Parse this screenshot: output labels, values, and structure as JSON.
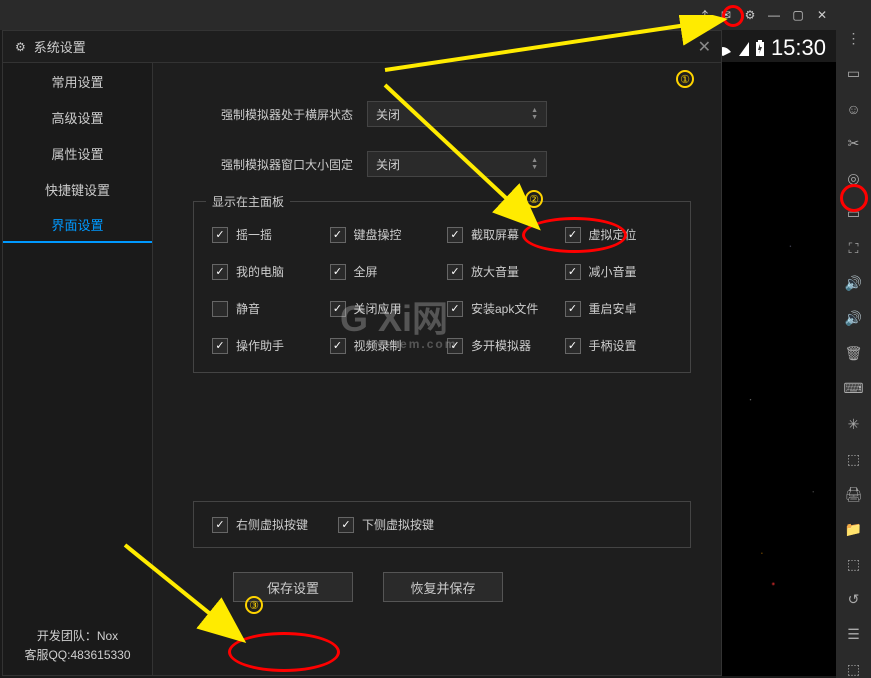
{
  "titlebar": {
    "icons": [
      "pin",
      "mail",
      "gear",
      "min",
      "max",
      "close"
    ]
  },
  "status": {
    "time": "15:30"
  },
  "dialog": {
    "title": "系统设置",
    "tabs": [
      "常用设置",
      "高级设置",
      "属性设置",
      "快捷键设置",
      "界面设置"
    ],
    "active_tab": 4,
    "row1": {
      "label": "强制模拟器处于横屏状态",
      "value": "关闭"
    },
    "row2": {
      "label": "强制模拟器窗口大小固定",
      "value": "关闭"
    },
    "panel_legend": "显示在主面板",
    "checks": [
      {
        "label": "摇一摇",
        "on": true
      },
      {
        "label": "键盘操控",
        "on": true
      },
      {
        "label": "截取屏幕",
        "on": true
      },
      {
        "label": "虚拟定位",
        "on": true
      },
      {
        "label": "我的电脑",
        "on": true
      },
      {
        "label": "全屏",
        "on": true
      },
      {
        "label": "放大音量",
        "on": true
      },
      {
        "label": "减小音量",
        "on": true
      },
      {
        "label": "静音",
        "on": false
      },
      {
        "label": "关闭应用",
        "on": true
      },
      {
        "label": "安装apk文件",
        "on": true
      },
      {
        "label": "重启安卓",
        "on": true
      },
      {
        "label": "操作助手",
        "on": true
      },
      {
        "label": "视频录制",
        "on": true
      },
      {
        "label": "多开模拟器",
        "on": true
      },
      {
        "label": "手柄设置",
        "on": true
      }
    ],
    "bottom_checks": [
      {
        "label": "右侧虚拟按键",
        "on": true
      },
      {
        "label": "下侧虚拟按键",
        "on": true
      }
    ],
    "buttons": {
      "save": "保存设置",
      "restore": "恢复并保存"
    },
    "footer": {
      "team": "开发团队：Nox",
      "qq": "客服QQ:483615330"
    }
  },
  "watermark": {
    "main": "G Xi网",
    "sub": "system.com"
  },
  "badges": {
    "one": "①",
    "two": "②",
    "three": "③"
  },
  "side_tools": [
    "⋮",
    "▭",
    "☺",
    "✂",
    "◎",
    "▭",
    "⛶",
    "🔊",
    "🔊",
    "🗑",
    "⌨",
    "✳",
    "⬚",
    "🖨",
    "📁",
    "⬚",
    "↺",
    "☰",
    "⬚"
  ]
}
